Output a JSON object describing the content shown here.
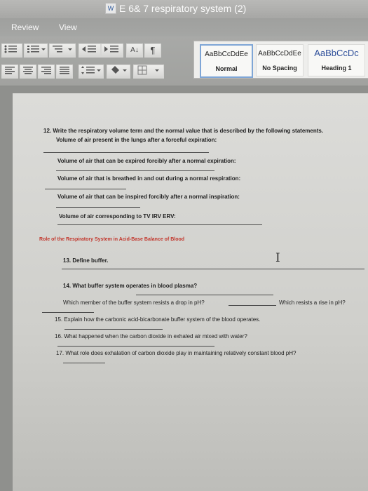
{
  "window": {
    "title": "E 6& 7 respiratory system (2)"
  },
  "menu_tabs": [
    "Review",
    "View"
  ],
  "styles": [
    {
      "sample": "AaBbCcDdEe",
      "label": "Normal"
    },
    {
      "sample": "AaBbCcDdEe",
      "label": "No Spacing"
    },
    {
      "sample": "AaBbCcDc",
      "label": "Heading 1"
    }
  ],
  "toolbar": {
    "pilcrow": "¶",
    "sort": "A↓"
  },
  "document": {
    "q12_title": "12. Write the respiratory volume term and the normal value that is described by the following statements.",
    "q12_a": "Volume of air present in the lungs after a forceful expiration:",
    "q12_b": "Volume of air that can be expired forcibly after a normal expiration:",
    "q12_c": "Volume of air that is breathed in and out during a normal respiration:",
    "q12_d": "Volume of air that can be inspired forcibly after a normal inspiration:",
    "q12_e": "Volume of air corresponding to TV  IRV  ERV:",
    "section_heading": "Role of the Respiratory System in Acid-Base Balance of Blood",
    "q13": "13. Define buffer.",
    "q14": "14. What buffer system operates in blood plasma?",
    "q14_drop": "Which member of the buffer system resists a drop in pH?",
    "q14_rise": "Which resists a rise in pH?",
    "q15": "15. Explain how the carbonic acid-bicarbonate buffer system of the blood operates.",
    "q16": "16. What happened when the carbon dioxide in exhaled air mixed with water?",
    "q17": "17. What role does exhalation of carbon dioxide play in maintaining relatively constant blood pH?"
  }
}
